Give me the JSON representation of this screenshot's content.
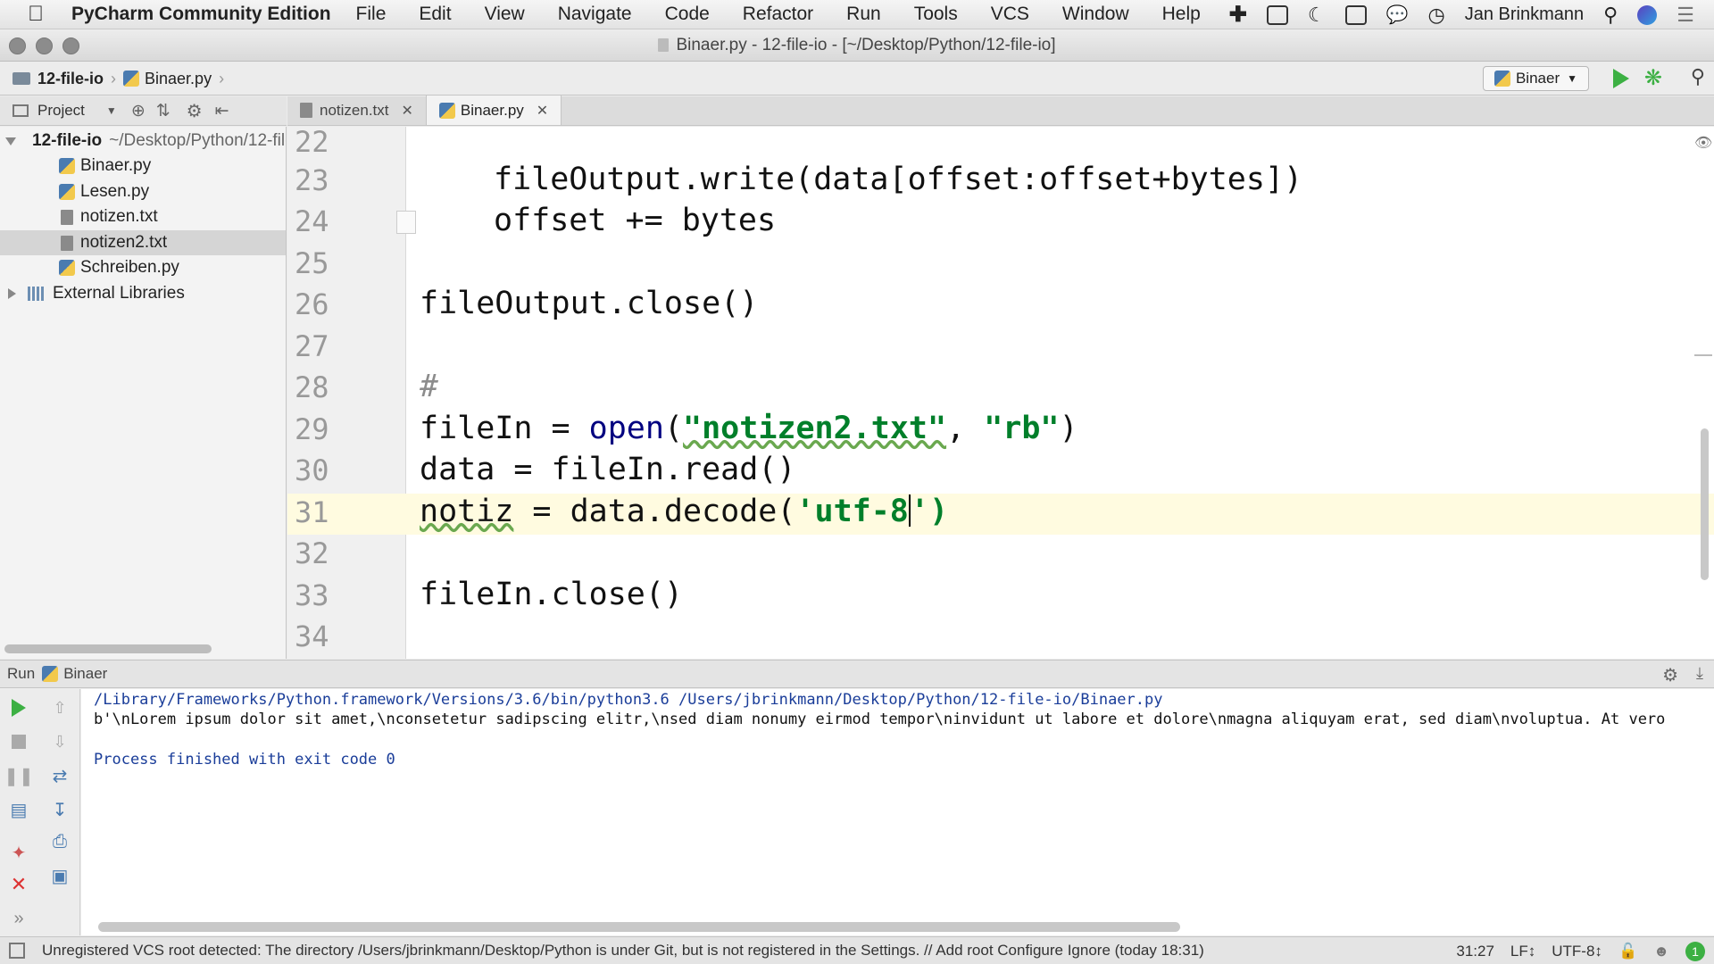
{
  "menubar": {
    "app_name": "PyCharm Community Edition",
    "items": [
      "File",
      "Edit",
      "View",
      "Navigate",
      "Code",
      "Refactor",
      "Run",
      "Tools",
      "VCS",
      "Window",
      "Help"
    ],
    "user": "Jan Brinkmann"
  },
  "window": {
    "title": "Binaer.py - 12-file-io - [~/Desktop/Python/12-file-io]"
  },
  "navbar": {
    "project": "12-file-io",
    "file": "Binaer.py",
    "run_config": "Binaer"
  },
  "project_panel": {
    "label": "Project"
  },
  "tabs": [
    {
      "label": "notizen.txt",
      "active": false
    },
    {
      "label": "Binaer.py",
      "active": true
    }
  ],
  "tree": {
    "root_name": "12-file-io",
    "root_path": "~/Desktop/Python/12-file-io",
    "files": [
      "Binaer.py",
      "Lesen.py",
      "notizen.txt",
      "notizen2.txt",
      "Schreiben.py"
    ],
    "selected": "notizen2.txt",
    "external": "External Libraries"
  },
  "editor": {
    "line_numbers": [
      "22",
      "23",
      "24",
      "25",
      "26",
      "27",
      "28",
      "29",
      "30",
      "31",
      "32",
      "33",
      "34"
    ],
    "current_line": "31",
    "lines": {
      "l23": "fileOutput.write(data[offset:offset+bytes])",
      "l24": "offset += bytes",
      "l26": "fileOutput.close()",
      "l28": "#",
      "l29a": "fileIn = ",
      "l29b": "open",
      "l29c": "(",
      "l29d": "\"notizen2.txt\"",
      "l29e": ", ",
      "l29f": "\"rb\"",
      "l29g": ")",
      "l30": "data = fileIn.read()",
      "l31a": "notiz",
      "l31b": " = data.decode(",
      "l31c": "'utf-8",
      "l31d": "')",
      "l33": "fileIn.close()"
    }
  },
  "run": {
    "label": "Run",
    "config": "Binaer",
    "cmd": "/Library/Frameworks/Python.framework/Versions/3.6/bin/python3.6 /Users/jbrinkmann/Desktop/Python/12-file-io/Binaer.py",
    "output": "b'\\nLorem ipsum dolor sit amet,\\nconsetetur sadipscing elitr,\\nsed diam nonumy eirmod tempor\\ninvidunt ut labore et dolore\\nmagna aliquyam erat, sed diam\\nvoluptua. At vero",
    "exit": "Process finished with exit code 0"
  },
  "status": {
    "message": "Unregistered VCS root detected: The directory /Users/jbrinkmann/Desktop/Python is under Git, but is not registered in the Settings. // Add root  Configure  Ignore (today 18:31)",
    "position": "31:27",
    "line_sep": "LF↕",
    "encoding": "UTF-8↕",
    "badge": "1"
  }
}
